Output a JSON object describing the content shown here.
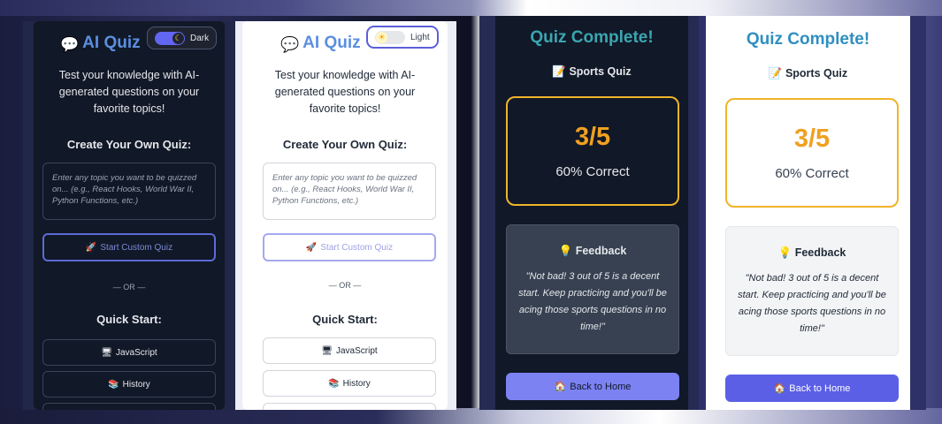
{
  "home": {
    "title": "AI Quiz",
    "intro": "Test your knowledge with AI-generated questions on your favorite topics!",
    "create_heading": "Create Your Own Quiz:",
    "topic_placeholder": "Enter any topic you want to be quizzed on... (e.g., React Hooks, World War II, Python Functions, etc.)",
    "start_custom_label": "Start Custom Quiz",
    "or_divider": "— OR —",
    "quick_start_heading": "Quick Start:",
    "topics": [
      {
        "label": "JavaScript",
        "icon": "🖥"
      },
      {
        "label": "History",
        "icon": "📚"
      }
    ]
  },
  "themes": {
    "dark_label": "Dark",
    "light_label": "Light"
  },
  "result": {
    "title": "Quiz Complete!",
    "quiz_name": "Sports Quiz",
    "score": "3/5",
    "percent": "60% Correct",
    "feedback_heading": "Feedback",
    "feedback_text": "\"Not bad! 3 out of 5 is a decent start. Keep practicing and you'll be acing those sports questions in no time!\"",
    "back_home_label": "Back to Home"
  },
  "colors": {
    "accent": "#6366f1",
    "score": "#f0a020",
    "title_gradient": "#3ba6b0"
  }
}
